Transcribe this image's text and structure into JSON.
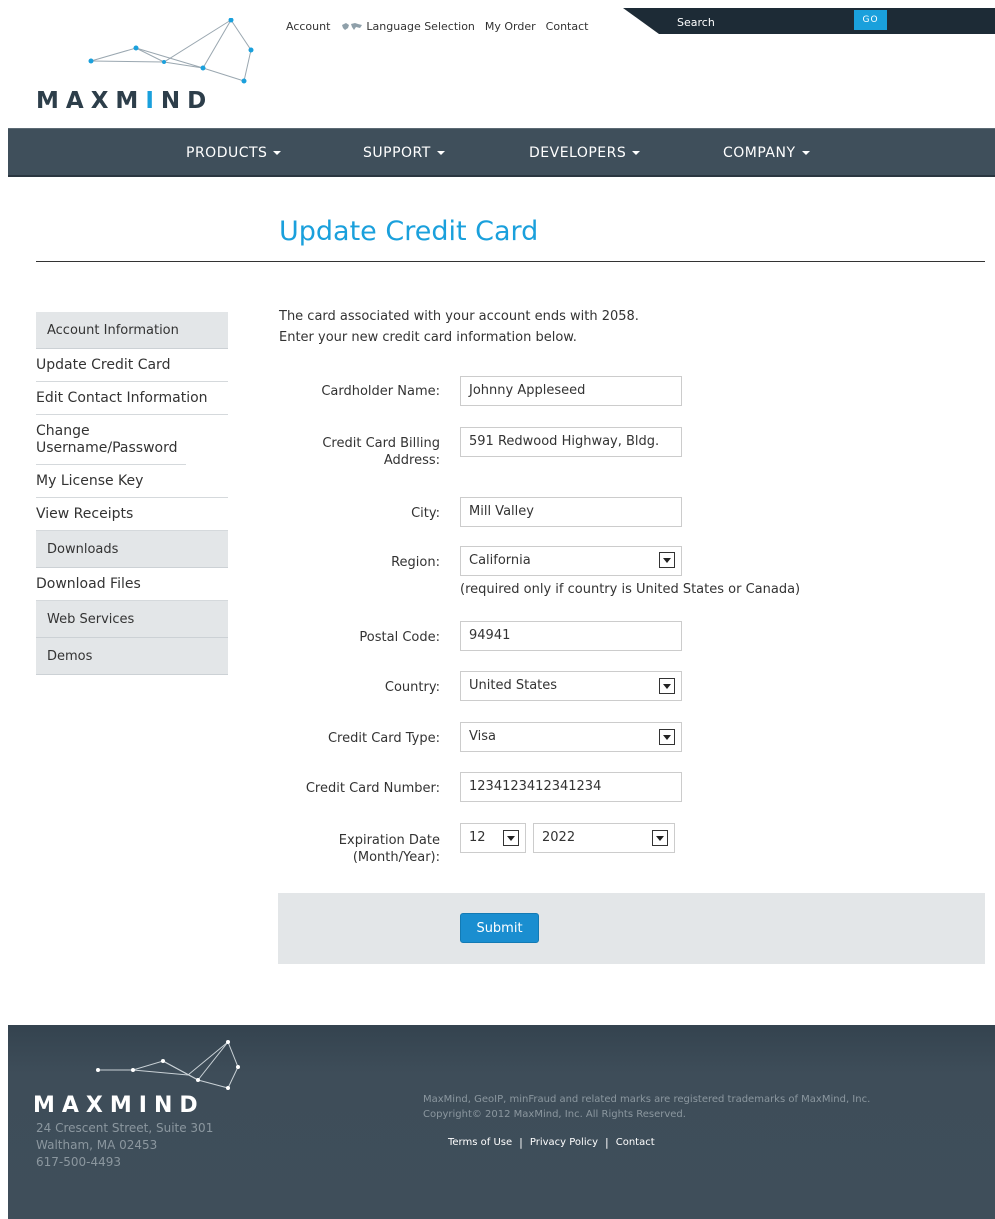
{
  "header": {
    "logo_text_a": "MAX",
    "logo_text_b": "M",
    "logo_text_c": "I",
    "logo_text_d": "ND",
    "links": [
      "Account",
      "Language Selection",
      "My Order",
      "Contact"
    ],
    "search_label": "Search",
    "go_label": "GO"
  },
  "nav": {
    "items": [
      "PRODUCTS",
      "SUPPORT",
      "DEVELOPERS",
      "COMPANY"
    ]
  },
  "page": {
    "title": "Update Credit Card"
  },
  "sidebar": {
    "account_heading": "Account Information",
    "account_links": [
      "Update Credit Card",
      "Edit Contact Information",
      "Change Username/Password",
      "My License Key",
      "View Receipts"
    ],
    "downloads_heading": "Downloads",
    "downloads_links": [
      "Download Files"
    ],
    "web_services_heading": "Web Services",
    "demos_heading": "Demos"
  },
  "form": {
    "intro_line1": "The card associated with your account ends with 2058.",
    "intro_line2": "Enter your new credit card information below.",
    "cardholder_label": "Cardholder Name:",
    "cardholder_value": "Johnny Appleseed",
    "billing_label_1": "Credit Card Billing",
    "billing_label_2": "Address:",
    "billing_value": "591 Redwood Highway, Bldg.",
    "city_label": "City:",
    "city_value": "Mill Valley",
    "region_label": "Region:",
    "region_value": "California",
    "region_note": "(required only if country is United States or Canada)",
    "postal_label": "Postal Code:",
    "postal_value": "94941",
    "country_label": "Country:",
    "country_value": "United States",
    "card_type_label": "Credit Card Type:",
    "card_type_value": "Visa",
    "card_number_label": "Credit Card Number:",
    "card_number_value": "1234123412341234",
    "expiration_label_1": "Expiration Date",
    "expiration_label_2": "(Month/Year):",
    "exp_month_value": "12",
    "exp_year_value": "2022",
    "submit_label": "Submit"
  },
  "footer": {
    "logo_text": "MAXMIND",
    "address_line1": "24 Crescent Street, Suite 301",
    "address_line2": "Waltham, MA 02453",
    "address_line3": "617-500-4493",
    "legal_line1": "MaxMind, GeoIP, minFraud and related marks are registered trademarks of MaxMind, Inc.",
    "legal_line2": "Copyright© 2012 MaxMind, Inc. All Rights Reserved.",
    "links": [
      "Terms of Use",
      "Privacy Policy",
      "Contact"
    ]
  },
  "colors": {
    "accent": "#1aa0dc",
    "nav_bg": "#3f4f5b",
    "footer_bg": "#3f4e5a",
    "sidebar_head_bg": "#e3e6e8"
  }
}
